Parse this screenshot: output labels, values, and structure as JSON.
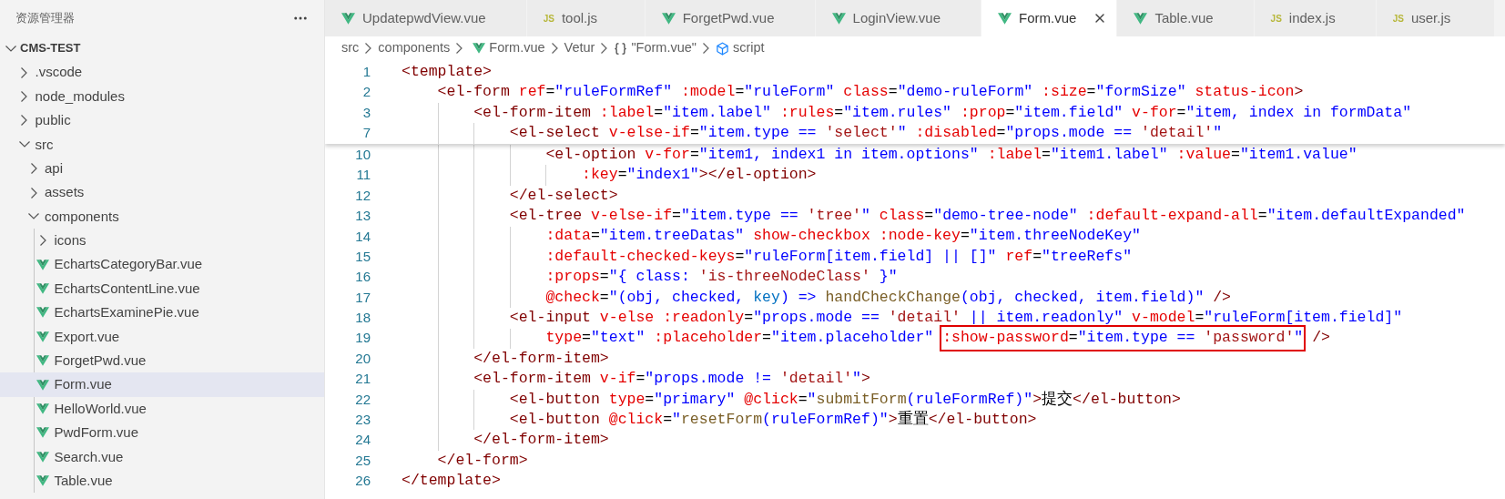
{
  "explorer": {
    "title": "资源管理器",
    "tree": [
      {
        "label": "CMS-TEST",
        "kind": "root",
        "expanded": true,
        "selected": false,
        "children": [
          {
            "label": ".vscode",
            "kind": "folder",
            "expanded": false,
            "selected": false
          },
          {
            "label": "node_modules",
            "kind": "folder",
            "expanded": false,
            "selected": false
          },
          {
            "label": "public",
            "kind": "folder",
            "expanded": false,
            "selected": false
          },
          {
            "label": "src",
            "kind": "folder",
            "expanded": true,
            "selected": false,
            "children": [
              {
                "label": "api",
                "kind": "folder",
                "expanded": false,
                "selected": false
              },
              {
                "label": "assets",
                "kind": "folder",
                "expanded": false,
                "selected": false
              },
              {
                "label": "components",
                "kind": "folder",
                "expanded": true,
                "selected": false,
                "children": [
                  {
                    "label": "icons",
                    "kind": "folder",
                    "expanded": false,
                    "selected": false
                  },
                  {
                    "label": "EchartsCategoryBar.vue",
                    "kind": "vue",
                    "selected": false
                  },
                  {
                    "label": "EchartsContentLine.vue",
                    "kind": "vue",
                    "selected": false
                  },
                  {
                    "label": "EchartsExaminePie.vue",
                    "kind": "vue",
                    "selected": false
                  },
                  {
                    "label": "Export.vue",
                    "kind": "vue",
                    "selected": false
                  },
                  {
                    "label": "ForgetPwd.vue",
                    "kind": "vue",
                    "selected": false
                  },
                  {
                    "label": "Form.vue",
                    "kind": "vue",
                    "selected": true
                  },
                  {
                    "label": "HelloWorld.vue",
                    "kind": "vue",
                    "selected": false
                  },
                  {
                    "label": "PwdForm.vue",
                    "kind": "vue",
                    "selected": false
                  },
                  {
                    "label": "Search.vue",
                    "kind": "vue",
                    "selected": false
                  },
                  {
                    "label": "Table.vue",
                    "kind": "vue",
                    "selected": false
                  }
                ]
              }
            ]
          }
        ]
      }
    ]
  },
  "tabs": [
    {
      "label": "UpdatepwdView.vue",
      "kind": "vue",
      "selected": false
    },
    {
      "label": "tool.js",
      "kind": "js",
      "badge": "JS",
      "selected": false
    },
    {
      "label": "ForgetPwd.vue",
      "kind": "vue",
      "selected": false
    },
    {
      "label": "LoginView.vue",
      "kind": "vue",
      "selected": false
    },
    {
      "label": "Form.vue",
      "kind": "vue",
      "selected": true
    },
    {
      "label": "Table.vue",
      "kind": "vue",
      "selected": false
    },
    {
      "label": "index.js",
      "kind": "js",
      "badge": "JS",
      "selected": false
    },
    {
      "label": "user.js",
      "kind": "js",
      "badge": "JS",
      "selected": false
    }
  ],
  "breadcrumb": [
    {
      "label": "src",
      "kind": "folder"
    },
    {
      "label": "components",
      "kind": "folder"
    },
    {
      "label": "Form.vue",
      "kind": "vue"
    },
    {
      "label": "Vetur",
      "kind": "language"
    },
    {
      "label": "\"Form.vue\"",
      "kind": "module"
    },
    {
      "label": "script",
      "kind": "element"
    }
  ],
  "sticky_lines": [
    {
      "number": "1",
      "tokens": [
        {
          "kind": "tag",
          "text": "<template>"
        }
      ]
    },
    {
      "number": "2",
      "tokens": [
        {
          "kind": "tag",
          "text": "    <el-form"
        },
        {
          "kind": "attr",
          "text": " ref"
        },
        {
          "kind": "punct",
          "text": "="
        },
        {
          "kind": "string",
          "text": "\"ruleFormRef\""
        },
        {
          "kind": "attr",
          "text": " :model"
        },
        {
          "kind": "punct",
          "text": "="
        },
        {
          "kind": "string",
          "text": "\"ruleForm\""
        },
        {
          "kind": "attr",
          "text": " class"
        },
        {
          "kind": "punct",
          "text": "="
        },
        {
          "kind": "string",
          "text": "\"demo-ruleForm\""
        },
        {
          "kind": "attr",
          "text": " :size"
        },
        {
          "kind": "punct",
          "text": "="
        },
        {
          "kind": "string",
          "text": "\"formSize\""
        },
        {
          "kind": "attr",
          "text": " status-icon"
        },
        {
          "kind": "tag",
          "text": ">"
        }
      ]
    },
    {
      "number": "3",
      "tokens": [
        {
          "kind": "tag",
          "text": "        <el-form-item"
        },
        {
          "kind": "attr",
          "text": " :label"
        },
        {
          "kind": "punct",
          "text": "="
        },
        {
          "kind": "string",
          "text": "\"item.label\""
        },
        {
          "kind": "attr",
          "text": " :rules"
        },
        {
          "kind": "punct",
          "text": "="
        },
        {
          "kind": "string",
          "text": "\"item.rules\""
        },
        {
          "kind": "attr",
          "text": " :prop"
        },
        {
          "kind": "punct",
          "text": "="
        },
        {
          "kind": "string",
          "text": "\"item.field\""
        },
        {
          "kind": "attr",
          "text": " v-for"
        },
        {
          "kind": "punct",
          "text": "="
        },
        {
          "kind": "string",
          "text": "\"item, index in formData\""
        }
      ]
    },
    {
      "number": "7",
      "tokens": [
        {
          "kind": "tag",
          "text": "            <el-select"
        },
        {
          "kind": "attr",
          "text": " v-else-if"
        },
        {
          "kind": "punct",
          "text": "="
        },
        {
          "kind": "string",
          "text": "\"item.type == "
        },
        {
          "kind": "literal",
          "text": "'select'"
        },
        {
          "kind": "string",
          "text": "\""
        },
        {
          "kind": "attr",
          "text": " :disabled"
        },
        {
          "kind": "punct",
          "text": "="
        },
        {
          "kind": "string",
          "text": "\"props.mode == "
        },
        {
          "kind": "literal",
          "text": "'detail'"
        },
        {
          "kind": "string",
          "text": "\""
        }
      ]
    }
  ],
  "lines": [
    {
      "number": "10",
      "tokens": [
        {
          "kind": "tag",
          "text": "                <el-option"
        },
        {
          "kind": "attr",
          "text": " v-for"
        },
        {
          "kind": "punct",
          "text": "="
        },
        {
          "kind": "string",
          "text": "\"item1, index1 in item.options\""
        },
        {
          "kind": "attr",
          "text": " :label"
        },
        {
          "kind": "punct",
          "text": "="
        },
        {
          "kind": "string",
          "text": "\"item1.label\""
        },
        {
          "kind": "attr",
          "text": " :value"
        },
        {
          "kind": "punct",
          "text": "="
        },
        {
          "kind": "string",
          "text": "\"item1.value\""
        }
      ]
    },
    {
      "number": "11",
      "tokens": [
        {
          "kind": "attr",
          "text": "                    :key"
        },
        {
          "kind": "punct",
          "text": "="
        },
        {
          "kind": "string",
          "text": "\"index1\""
        },
        {
          "kind": "tag",
          "text": "></el-option>"
        }
      ]
    },
    {
      "number": "12",
      "tokens": [
        {
          "kind": "tag",
          "text": "            </el-select>"
        }
      ]
    },
    {
      "number": "13",
      "tokens": [
        {
          "kind": "tag",
          "text": "            <el-tree"
        },
        {
          "kind": "attr",
          "text": " v-else-if"
        },
        {
          "kind": "punct",
          "text": "="
        },
        {
          "kind": "string",
          "text": "\"item.type == "
        },
        {
          "kind": "literal",
          "text": "'tree'"
        },
        {
          "kind": "string",
          "text": "\""
        },
        {
          "kind": "attr",
          "text": " class"
        },
        {
          "kind": "punct",
          "text": "="
        },
        {
          "kind": "string",
          "text": "\"demo-tree-node\""
        },
        {
          "kind": "attr",
          "text": " :default-expand-all"
        },
        {
          "kind": "punct",
          "text": "="
        },
        {
          "kind": "string",
          "text": "\"item.defaultExpanded\""
        }
      ]
    },
    {
      "number": "14",
      "tokens": [
        {
          "kind": "attr",
          "text": "                :data"
        },
        {
          "kind": "punct",
          "text": "="
        },
        {
          "kind": "string",
          "text": "\"item.treeDatas\""
        },
        {
          "kind": "attr",
          "text": " show-checkbox"
        },
        {
          "kind": "attr",
          "text": " :node-key"
        },
        {
          "kind": "punct",
          "text": "="
        },
        {
          "kind": "string",
          "text": "\"item.threeNodeKey\""
        }
      ]
    },
    {
      "number": "15",
      "tokens": [
        {
          "kind": "attr",
          "text": "                :default-checked-keys"
        },
        {
          "kind": "punct",
          "text": "="
        },
        {
          "kind": "string",
          "text": "\"ruleForm[item.field] || []\""
        },
        {
          "kind": "attr",
          "text": " ref"
        },
        {
          "kind": "punct",
          "text": "="
        },
        {
          "kind": "string",
          "text": "\"treeRefs\""
        }
      ]
    },
    {
      "number": "16",
      "tokens": [
        {
          "kind": "attr",
          "text": "                :props"
        },
        {
          "kind": "punct",
          "text": "="
        },
        {
          "kind": "string",
          "text": "\"{ class: "
        },
        {
          "kind": "literal",
          "text": "'is-threeNodeClass'"
        },
        {
          "kind": "string",
          "text": " }\""
        }
      ]
    },
    {
      "number": "17",
      "tokens": [
        {
          "kind": "attr",
          "text": "                @check"
        },
        {
          "kind": "punct",
          "text": "="
        },
        {
          "kind": "string",
          "text": "\"(obj, checked, "
        },
        {
          "kind": "variable",
          "text": "key"
        },
        {
          "kind": "string",
          "text": ") => "
        },
        {
          "kind": "function",
          "text": "handCheckChange"
        },
        {
          "kind": "string",
          "text": "(obj, checked, item.field)\""
        },
        {
          "kind": "tag",
          "text": " />"
        }
      ]
    },
    {
      "number": "18",
      "tokens": [
        {
          "kind": "tag",
          "text": "            <el-input"
        },
        {
          "kind": "attr",
          "text": " v-else"
        },
        {
          "kind": "attr",
          "text": " :readonly"
        },
        {
          "kind": "punct",
          "text": "="
        },
        {
          "kind": "string",
          "text": "\"props.mode == "
        },
        {
          "kind": "literal",
          "text": "'detail'"
        },
        {
          "kind": "string",
          "text": " || item.readonly\""
        },
        {
          "kind": "attr",
          "text": " v-model"
        },
        {
          "kind": "punct",
          "text": "="
        },
        {
          "kind": "string",
          "text": "\"ruleForm[item.field]\""
        }
      ]
    },
    {
      "number": "19",
      "tokens": [
        {
          "kind": "attr",
          "text": "                type"
        },
        {
          "kind": "punct",
          "text": "="
        },
        {
          "kind": "string",
          "text": "\"text\""
        },
        {
          "kind": "attr",
          "text": " :placeholder"
        },
        {
          "kind": "punct",
          "text": "="
        },
        {
          "kind": "string",
          "text": "\"item.placeholder\" "
        },
        {
          "kind": "box",
          "children": [
            {
              "kind": "attr",
              "text": ":show-password"
            },
            {
              "kind": "punct",
              "text": "="
            },
            {
              "kind": "string",
              "text": "\"item.type == "
            },
            {
              "kind": "literal",
              "text": "'password'"
            },
            {
              "kind": "string",
              "text": "\""
            }
          ]
        },
        {
          "kind": "tag",
          "text": " />"
        }
      ]
    },
    {
      "number": "20",
      "tokens": [
        {
          "kind": "tag",
          "text": "        </el-form-item>"
        }
      ]
    },
    {
      "number": "21",
      "tokens": [
        {
          "kind": "tag",
          "text": "        <el-form-item"
        },
        {
          "kind": "attr",
          "text": " v-if"
        },
        {
          "kind": "punct",
          "text": "="
        },
        {
          "kind": "string",
          "text": "\"props.mode != "
        },
        {
          "kind": "literal",
          "text": "'detail'"
        },
        {
          "kind": "string",
          "text": "\""
        },
        {
          "kind": "tag",
          "text": ">"
        }
      ]
    },
    {
      "number": "22",
      "tokens": [
        {
          "kind": "tag",
          "text": "            <el-button"
        },
        {
          "kind": "attr",
          "text": " type"
        },
        {
          "kind": "punct",
          "text": "="
        },
        {
          "kind": "string",
          "text": "\"primary\""
        },
        {
          "kind": "attr",
          "text": " @click"
        },
        {
          "kind": "punct",
          "text": "="
        },
        {
          "kind": "string",
          "text": "\""
        },
        {
          "kind": "function",
          "text": "submitForm"
        },
        {
          "kind": "string",
          "text": "(ruleFormRef)\""
        },
        {
          "kind": "tag",
          "text": ">"
        },
        {
          "kind": "punct",
          "text": "提交"
        },
        {
          "kind": "tag",
          "text": "</el-button>"
        }
      ]
    },
    {
      "number": "23",
      "tokens": [
        {
          "kind": "tag",
          "text": "            <el-button"
        },
        {
          "kind": "attr",
          "text": " @click"
        },
        {
          "kind": "punct",
          "text": "="
        },
        {
          "kind": "string",
          "text": "\""
        },
        {
          "kind": "function",
          "text": "resetForm"
        },
        {
          "kind": "string",
          "text": "(ruleFormRef)\""
        },
        {
          "kind": "tag",
          "text": ">"
        },
        {
          "kind": "punct",
          "text": "重置"
        },
        {
          "kind": "tag",
          "text": "</el-button>"
        }
      ]
    },
    {
      "number": "24",
      "tokens": [
        {
          "kind": "tag",
          "text": "        </el-form-item>"
        }
      ]
    },
    {
      "number": "25",
      "tokens": [
        {
          "kind": "tag",
          "text": "    </el-form>"
        }
      ]
    },
    {
      "number": "26",
      "tokens": [
        {
          "kind": "tag",
          "text": "</template>"
        }
      ]
    }
  ]
}
